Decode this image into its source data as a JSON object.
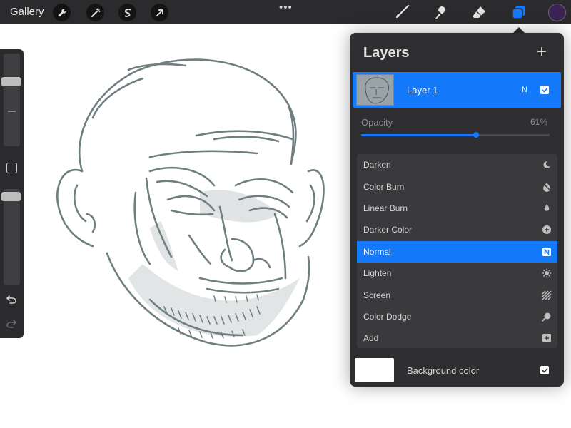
{
  "topbar": {
    "gallery_label": "Gallery",
    "left_tools": [
      "wrench-icon",
      "magic-wand-icon",
      "selection-icon",
      "transform-arrow-icon"
    ],
    "more_label": "•••",
    "right_tools": [
      "brush-icon",
      "smudge-icon",
      "eraser-icon",
      "layers-icon"
    ],
    "current_color": "#3b2356",
    "active_tool_color": "#1479fb"
  },
  "sidebar": {
    "brush_size_level": 0.72,
    "brush_opacity_level": 0.97,
    "undo_icon": "undo-icon",
    "redo_icon": "redo-icon"
  },
  "layers_panel": {
    "title": "Layers",
    "add_icon": "+",
    "layer": {
      "name": "Layer 1",
      "blend_mode_short": "N",
      "visible": true
    },
    "opacity": {
      "label": "Opacity",
      "value_text": "61%",
      "value": 0.61
    },
    "blend_modes": [
      {
        "label": "Darken",
        "icon": "moon-icon",
        "active": false
      },
      {
        "label": "Color Burn",
        "icon": "burn-icon",
        "active": false
      },
      {
        "label": "Linear Burn",
        "icon": "flame-icon",
        "active": false
      },
      {
        "label": "Darker Color",
        "icon": "plus-circle-icon",
        "active": false
      },
      {
        "label": "Normal",
        "icon": "normal-n-icon",
        "active": true,
        "badge": "N"
      },
      {
        "label": "Lighten",
        "icon": "sun-icon",
        "active": false
      },
      {
        "label": "Screen",
        "icon": "stripes-icon",
        "active": false
      },
      {
        "label": "Color Dodge",
        "icon": "dodge-icon",
        "active": false
      },
      {
        "label": "Add",
        "icon": "plus-square-icon",
        "active": false
      }
    ],
    "background": {
      "label": "Background color",
      "color": "#ffffff",
      "visible": true
    }
  }
}
